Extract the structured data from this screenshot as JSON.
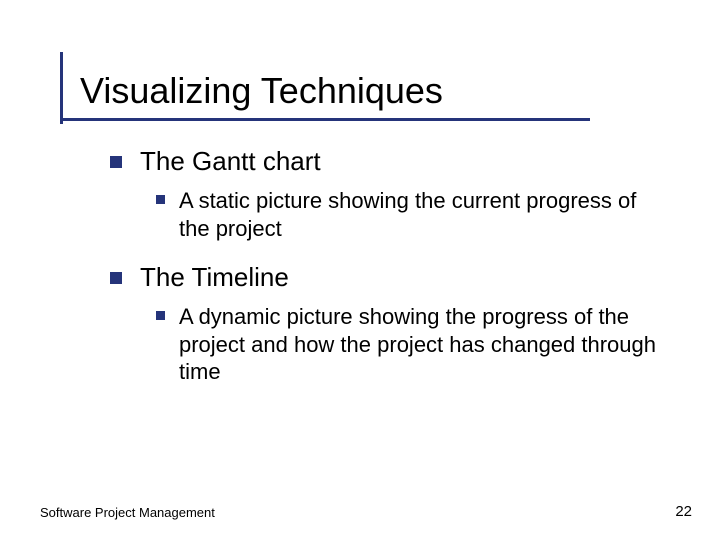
{
  "title": "Visualizing Techniques",
  "items": [
    {
      "label": "The Gantt chart",
      "sub": [
        "A static picture showing the current progress of the project"
      ]
    },
    {
      "label": "The Timeline",
      "sub": [
        "A dynamic picture showing the progress of the project and how the project has changed through time"
      ]
    }
  ],
  "footer": {
    "left": "Software Project Management",
    "right": "22"
  },
  "colors": {
    "accent": "#25347a"
  }
}
